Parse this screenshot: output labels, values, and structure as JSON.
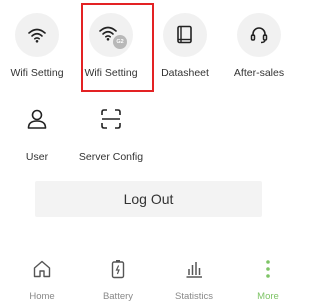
{
  "grid": {
    "items": [
      {
        "label": "Wifi Setting",
        "icon": "wifi-icon"
      },
      {
        "label": "Wifi Setting",
        "icon": "wifi-g2-icon",
        "badge": "G2"
      },
      {
        "label": "Datasheet",
        "icon": "datasheet-icon"
      },
      {
        "label": "After-sales",
        "icon": "headset-icon"
      },
      {
        "label": "User",
        "icon": "user-icon"
      },
      {
        "label": "Server Config",
        "icon": "scan-frame-icon"
      }
    ]
  },
  "logout": {
    "label": "Log Out"
  },
  "tabbar": {
    "tabs": [
      {
        "label": "Home",
        "icon": "home-icon"
      },
      {
        "label": "Battery",
        "icon": "battery-icon"
      },
      {
        "label": "Statistics",
        "icon": "bar-chart-icon"
      },
      {
        "label": "More",
        "icon": "more-dots-icon",
        "active": true
      }
    ],
    "active_color": "#7ec466"
  },
  "colors": {
    "selection_border": "#e32224",
    "icon_bg": "#f1f1f1"
  }
}
